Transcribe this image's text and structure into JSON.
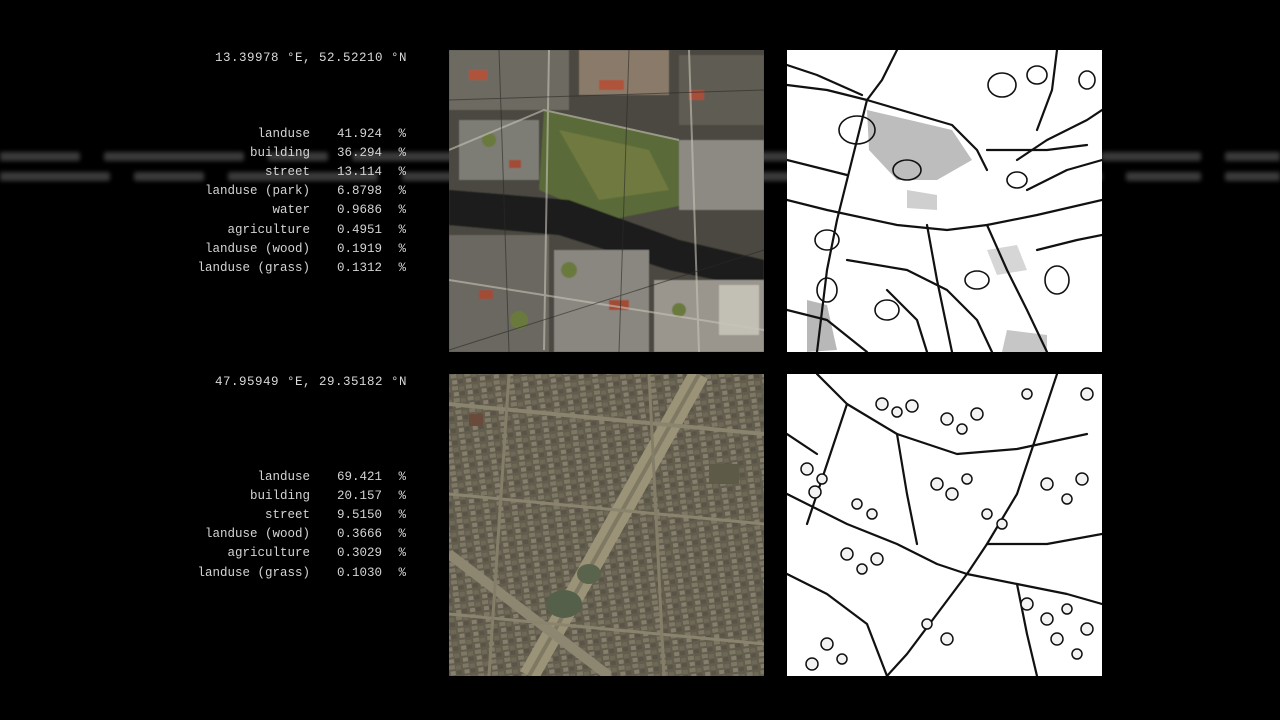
{
  "rows": [
    {
      "coords": "13.39978 °E, 52.52210 °N",
      "stats": [
        {
          "label": "landuse",
          "value": "41.924",
          "unit": "%"
        },
        {
          "label": "building",
          "value": "36.294",
          "unit": "%"
        },
        {
          "label": "street",
          "value": "13.114",
          "unit": "%"
        },
        {
          "label": "landuse (park)",
          "value": "6.8798",
          "unit": "%"
        },
        {
          "label": "water",
          "value": "0.9686",
          "unit": "%"
        },
        {
          "label": "agriculture",
          "value": "0.4951",
          "unit": "%"
        },
        {
          "label": "landuse (wood)",
          "value": "0.1919",
          "unit": "%"
        },
        {
          "label": "landuse (grass)",
          "value": "0.1312",
          "unit": "%"
        }
      ]
    },
    {
      "coords": "47.95949 °E, 29.35182 °N",
      "stats": [
        {
          "label": "landuse",
          "value": "69.421",
          "unit": "%"
        },
        {
          "label": "building",
          "value": "20.157",
          "unit": "%"
        },
        {
          "label": "street",
          "value": "9.5150",
          "unit": "%"
        },
        {
          "label": "landuse (wood)",
          "value": "0.3666",
          "unit": "%"
        },
        {
          "label": "agriculture",
          "value": "0.3029",
          "unit": "%"
        },
        {
          "label": "landuse (grass)",
          "value": "0.1030",
          "unit": "%"
        }
      ]
    }
  ],
  "colors": {
    "background": "#000000",
    "text": "#d4d4d4",
    "sketch_line": "#000000",
    "sketch_paper": "#ffffff"
  }
}
